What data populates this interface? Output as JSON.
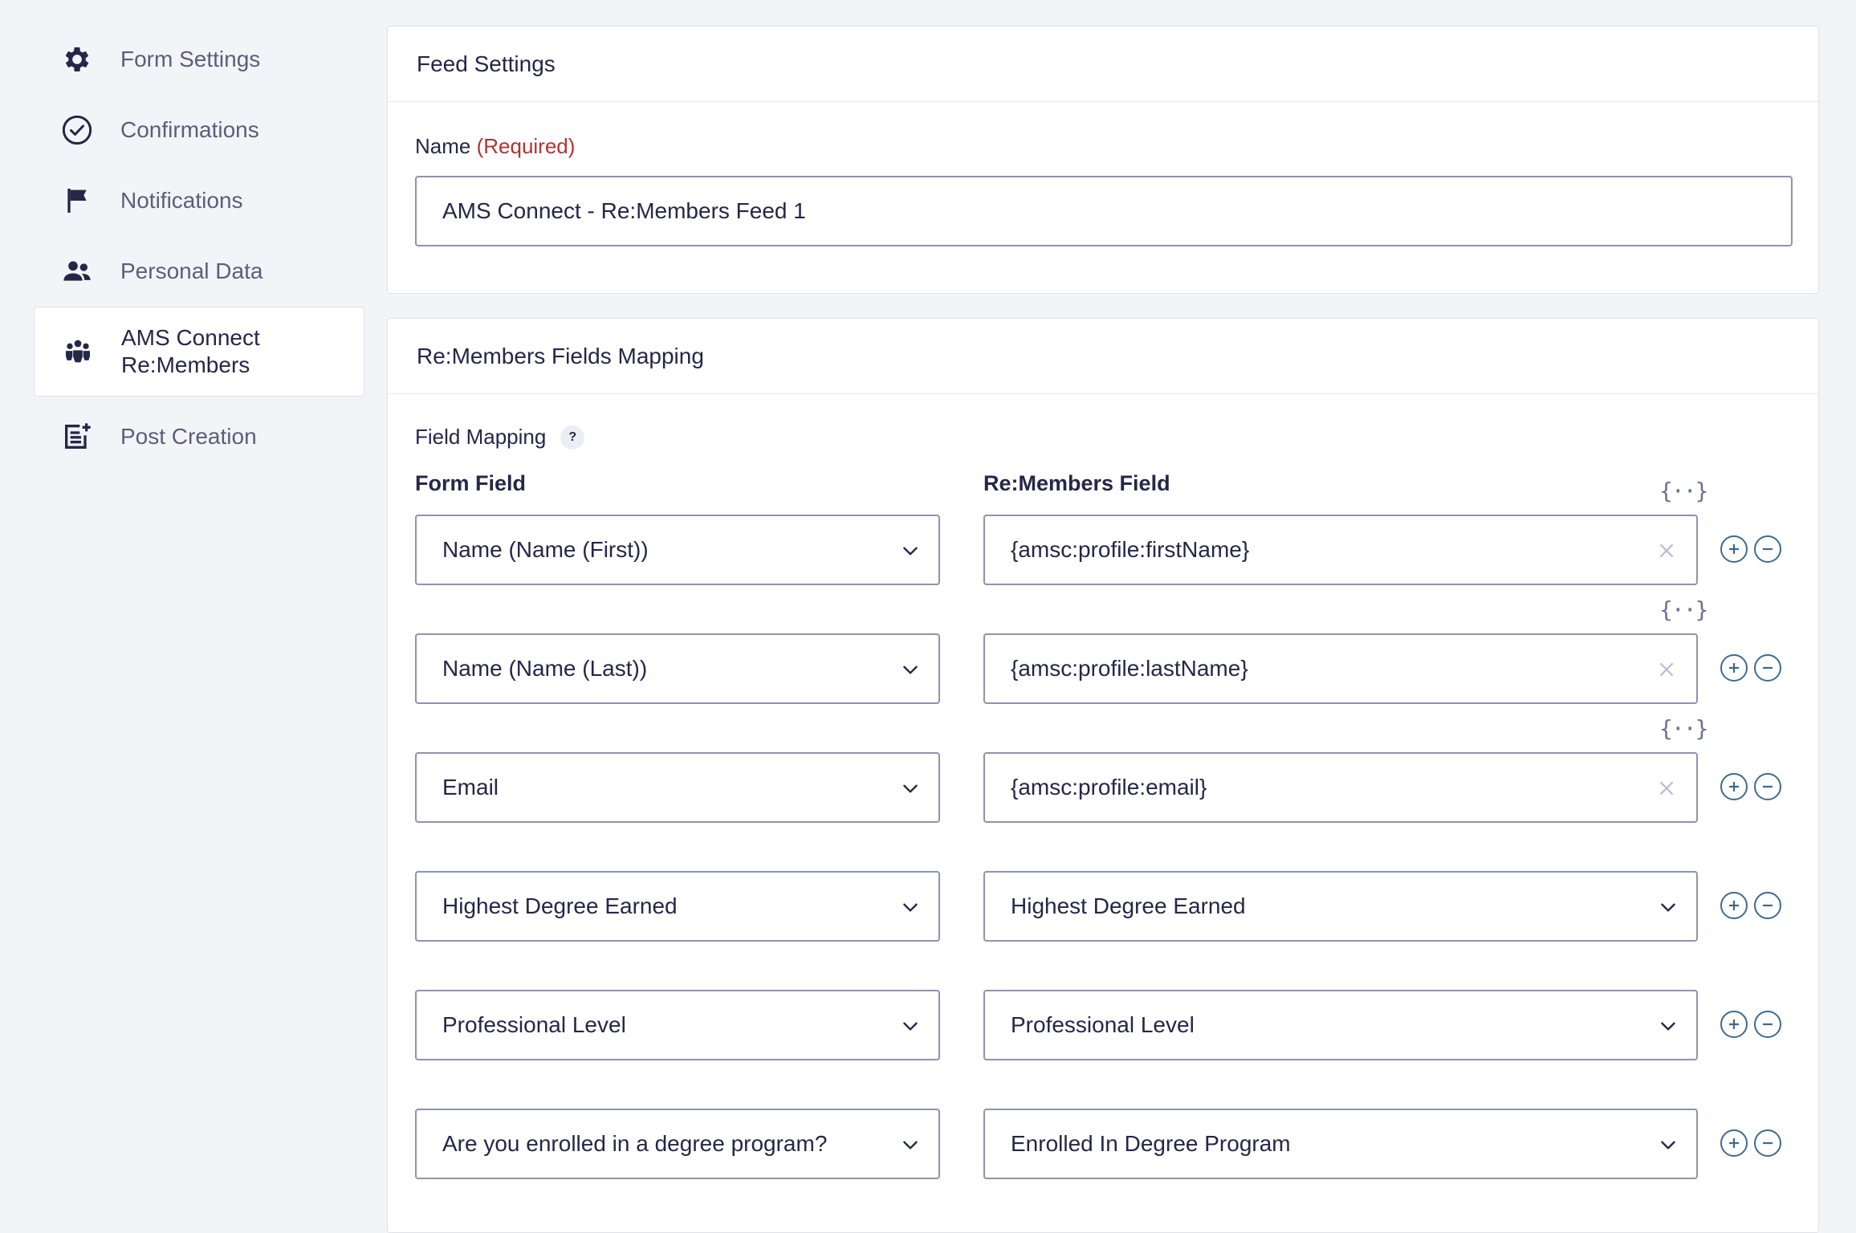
{
  "sidebar": {
    "items": [
      {
        "label": "Form Settings",
        "icon": "gear-icon"
      },
      {
        "label": "Confirmations",
        "icon": "check-circle-icon"
      },
      {
        "label": "Notifications",
        "icon": "flag-icon"
      },
      {
        "label": "Personal Data",
        "icon": "users-icon"
      },
      {
        "label": "AMS Connect Re:Members",
        "icon": "group-icon",
        "active": true
      },
      {
        "label": "Post Creation",
        "icon": "post-add-icon"
      }
    ]
  },
  "feed_settings": {
    "title": "Feed Settings",
    "name_label": "Name",
    "required_label": "(Required)",
    "name_value": "AMS Connect - Re:Members Feed 1"
  },
  "mapping": {
    "title": "Re:Members Fields Mapping",
    "field_mapping_label": "Field Mapping",
    "help_glyph": "?",
    "form_field_header": "Form Field",
    "remembers_field_header": "Re:Members Field",
    "merge_tag_glyph": "{··}",
    "rows": [
      {
        "form_field": "Name (Name (First))",
        "remembers_field": "{amsc:profile:firstName}",
        "type": "text"
      },
      {
        "form_field": "Name (Name (Last))",
        "remembers_field": "{amsc:profile:lastName}",
        "type": "text"
      },
      {
        "form_field": "Email",
        "remembers_field": "{amsc:profile:email}",
        "type": "text"
      },
      {
        "form_field": "Highest Degree Earned",
        "remembers_field": "Highest Degree Earned",
        "type": "select"
      },
      {
        "form_field": "Professional Level",
        "remembers_field": "Professional Level",
        "type": "select"
      },
      {
        "form_field": "Are you enrolled in a degree program?",
        "remembers_field": "Enrolled In Degree Program",
        "type": "select"
      }
    ]
  },
  "colors": {
    "accent": "#3e6a8f",
    "required": "#b0332e",
    "border": "#9092b2",
    "background": "#f3f4f8"
  }
}
